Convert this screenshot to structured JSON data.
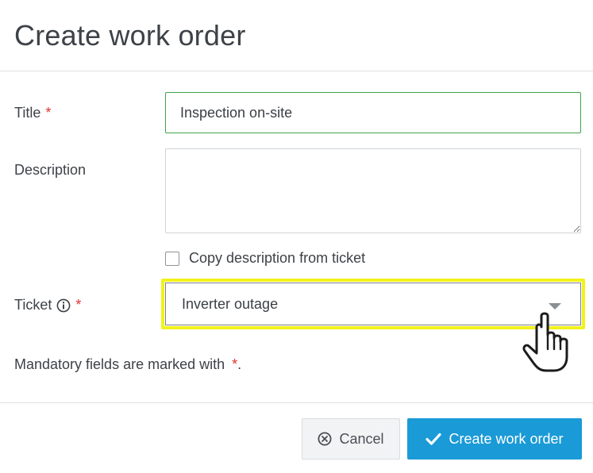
{
  "dialog": {
    "title": "Create work order",
    "required_marker": "*"
  },
  "form": {
    "title_label": "Title",
    "title_value": "Inspection on-site",
    "description_label": "Description",
    "description_value": "",
    "copy_description_label": "Copy description from ticket",
    "copy_description_checked": false,
    "ticket_label": "Ticket",
    "ticket_info_icon": "info-circle-icon",
    "ticket_value": "Inverter outage",
    "mandatory_note": "Mandatory fields are marked with",
    "mandatory_note_end": "."
  },
  "footer": {
    "cancel_label": "Cancel",
    "cancel_icon": "times-circle-icon",
    "create_label": "Create work order",
    "create_icon": "check-icon"
  },
  "colors": {
    "required": "#e0322f",
    "primary_button": "#1a9ad6",
    "valid_border": "#3fa24a",
    "highlight": "#f2f21c"
  },
  "overlay": {
    "cursor_icon": "hand-pointer-icon"
  }
}
